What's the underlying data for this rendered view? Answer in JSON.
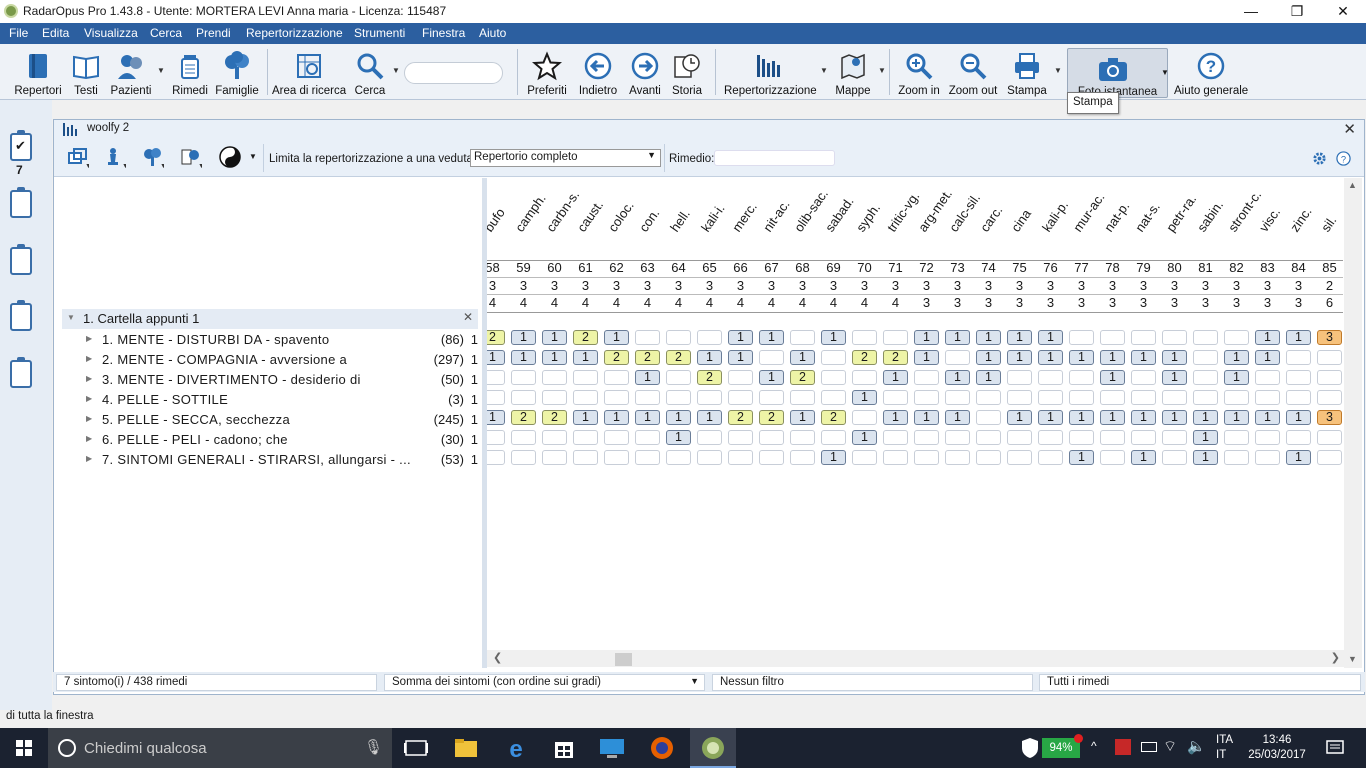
{
  "window": {
    "title": "RadarOpus Pro 1.43.8 - Utente: MORTERA LEVI Anna maria - Licenza: 115487"
  },
  "menu": [
    "File",
    "Edita",
    "Visualizza",
    "Cerca",
    "Prendi",
    "Repertorizzazione",
    "Strumenti",
    "Finestra",
    "Aiuto"
  ],
  "toolbar": {
    "repertori": "Repertori",
    "testi": "Testi",
    "pazienti": "Pazienti",
    "rimedi": "Rimedi",
    "famiglie": "Famiglie",
    "area": "Area di ricerca",
    "cerca": "Cerca",
    "preferiti": "Preferiti",
    "indietro": "Indietro",
    "avanti": "Avanti",
    "storia": "Storia",
    "repertorizzazione": "Repertorizzazione",
    "mappe": "Mappe",
    "zoom_in": "Zoom in",
    "zoom_out": "Zoom out",
    "stampa": "Stampa",
    "istantanea": "Foto istantanea",
    "aiuto": "Aiuto generale",
    "tooltip": "Stampa"
  },
  "sidebar": {
    "clipboard_count": "7"
  },
  "doc": {
    "title": "woolfy 2",
    "limita_label": "Limita la repertorizzazione a una veduta:",
    "veduta": "Repertorio completo",
    "rimedio_label": "Rimedio:"
  },
  "folder": {
    "label": "1. Cartella appunti 1"
  },
  "symptoms": [
    {
      "text": "1. MENTE - DISTURBI DA - spavento",
      "count": "(86)",
      "w": "1"
    },
    {
      "text": "2. MENTE - COMPAGNIA - avversione a",
      "count": "(297)",
      "w": "1"
    },
    {
      "text": "3. MENTE - DIVERTIMENTO - desiderio di",
      "count": "(50)",
      "w": "1"
    },
    {
      "text": "4. PELLE - SOTTILE",
      "count": "(3)",
      "w": "1"
    },
    {
      "text": "5. PELLE - SECCA, secchezza",
      "count": "(245)",
      "w": "1"
    },
    {
      "text": "6. PELLE - PELI - cadono; che",
      "count": "(30)",
      "w": "1"
    },
    {
      "text": "7. SINTOMI GENERALI - STIRARSI, allungarsi - ...",
      "count": "(53)",
      "w": "1"
    }
  ],
  "remedies": [
    {
      "name": "bufo",
      "num": "58",
      "v1": "3",
      "v2": "4",
      "cells": [
        2,
        1,
        0,
        0,
        1,
        0,
        0
      ]
    },
    {
      "name": "camph.",
      "num": "59",
      "v1": "3",
      "v2": "4",
      "cells": [
        1,
        1,
        0,
        0,
        2,
        0,
        0
      ]
    },
    {
      "name": "carbn-s.",
      "num": "60",
      "v1": "3",
      "v2": "4",
      "cells": [
        1,
        1,
        0,
        0,
        2,
        0,
        0
      ]
    },
    {
      "name": "caust.",
      "num": "61",
      "v1": "3",
      "v2": "4",
      "cells": [
        2,
        1,
        0,
        0,
        1,
        0,
        0
      ]
    },
    {
      "name": "coloc.",
      "num": "62",
      "v1": "3",
      "v2": "4",
      "cells": [
        1,
        2,
        0,
        0,
        1,
        0,
        0
      ]
    },
    {
      "name": "con.",
      "num": "63",
      "v1": "3",
      "v2": "4",
      "cells": [
        0,
        2,
        1,
        0,
        1,
        0,
        0
      ]
    },
    {
      "name": "hell.",
      "num": "64",
      "v1": "3",
      "v2": "4",
      "cells": [
        0,
        2,
        0,
        0,
        1,
        1,
        0
      ]
    },
    {
      "name": "kali-i.",
      "num": "65",
      "v1": "3",
      "v2": "4",
      "cells": [
        0,
        1,
        2,
        0,
        1,
        0,
        0
      ]
    },
    {
      "name": "merc.",
      "num": "66",
      "v1": "3",
      "v2": "4",
      "cells": [
        1,
        1,
        0,
        0,
        2,
        0,
        0
      ]
    },
    {
      "name": "nit-ac.",
      "num": "67",
      "v1": "3",
      "v2": "4",
      "cells": [
        1,
        0,
        1,
        0,
        2,
        0,
        0
      ]
    },
    {
      "name": "olib-sac.",
      "num": "68",
      "v1": "3",
      "v2": "4",
      "cells": [
        0,
        1,
        2,
        0,
        1,
        0,
        0
      ]
    },
    {
      "name": "sabad.",
      "num": "69",
      "v1": "3",
      "v2": "4",
      "cells": [
        1,
        0,
        0,
        0,
        2,
        0,
        1
      ]
    },
    {
      "name": "syph.",
      "num": "70",
      "v1": "3",
      "v2": "4",
      "cells": [
        0,
        2,
        0,
        1,
        0,
        1,
        0
      ]
    },
    {
      "name": "tritic-vg.",
      "num": "71",
      "v1": "3",
      "v2": "4",
      "cells": [
        0,
        2,
        1,
        0,
        1,
        0,
        0
      ]
    },
    {
      "name": "arg-met.",
      "num": "72",
      "v1": "3",
      "v2": "3",
      "cells": [
        1,
        1,
        0,
        0,
        1,
        0,
        0
      ]
    },
    {
      "name": "calc-sil.",
      "num": "73",
      "v1": "3",
      "v2": "3",
      "cells": [
        1,
        0,
        1,
        0,
        1,
        0,
        0
      ]
    },
    {
      "name": "carc.",
      "num": "74",
      "v1": "3",
      "v2": "3",
      "cells": [
        1,
        1,
        1,
        0,
        0,
        0,
        0
      ]
    },
    {
      "name": "cina",
      "num": "75",
      "v1": "3",
      "v2": "3",
      "cells": [
        1,
        1,
        0,
        0,
        1,
        0,
        0
      ]
    },
    {
      "name": "kali-p.",
      "num": "76",
      "v1": "3",
      "v2": "3",
      "cells": [
        1,
        1,
        0,
        0,
        1,
        0,
        0
      ]
    },
    {
      "name": "mur-ac.",
      "num": "77",
      "v1": "3",
      "v2": "3",
      "cells": [
        0,
        1,
        0,
        0,
        1,
        0,
        1
      ]
    },
    {
      "name": "nat-p.",
      "num": "78",
      "v1": "3",
      "v2": "3",
      "cells": [
        0,
        1,
        1,
        0,
        1,
        0,
        0
      ]
    },
    {
      "name": "nat-s.",
      "num": "79",
      "v1": "3",
      "v2": "3",
      "cells": [
        0,
        1,
        0,
        0,
        1,
        0,
        1
      ]
    },
    {
      "name": "petr-ra.",
      "num": "80",
      "v1": "3",
      "v2": "3",
      "cells": [
        0,
        1,
        1,
        0,
        1,
        0,
        0
      ]
    },
    {
      "name": "sabin.",
      "num": "81",
      "v1": "3",
      "v2": "3",
      "cells": [
        0,
        0,
        0,
        0,
        1,
        1,
        1
      ]
    },
    {
      "name": "stront-c.",
      "num": "82",
      "v1": "3",
      "v2": "3",
      "cells": [
        0,
        1,
        1,
        0,
        1,
        0,
        0
      ]
    },
    {
      "name": "visc.",
      "num": "83",
      "v1": "3",
      "v2": "3",
      "cells": [
        1,
        1,
        0,
        0,
        1,
        0,
        0
      ]
    },
    {
      "name": "zinc.",
      "num": "84",
      "v1": "3",
      "v2": "3",
      "cells": [
        1,
        0,
        0,
        0,
        1,
        0,
        1
      ]
    },
    {
      "name": "sil.",
      "num": "85",
      "v1": "2",
      "v2": "6",
      "cells": [
        3,
        0,
        0,
        0,
        3,
        0,
        0
      ]
    }
  ],
  "status": {
    "summary": "7 sintomo(i) / 438 rimedi",
    "method": "Somma dei sintomi (con ordine sui gradi)",
    "filter": "Nessun filtro",
    "remedies": "Tutti i rimedi"
  },
  "hint": "di tutta la finestra",
  "taskbar": {
    "search": "Chiedimi qualcosa",
    "battery": "94%",
    "lang1": "ITA",
    "lang2": "IT",
    "time": "13:46",
    "date": "25/03/2017"
  }
}
